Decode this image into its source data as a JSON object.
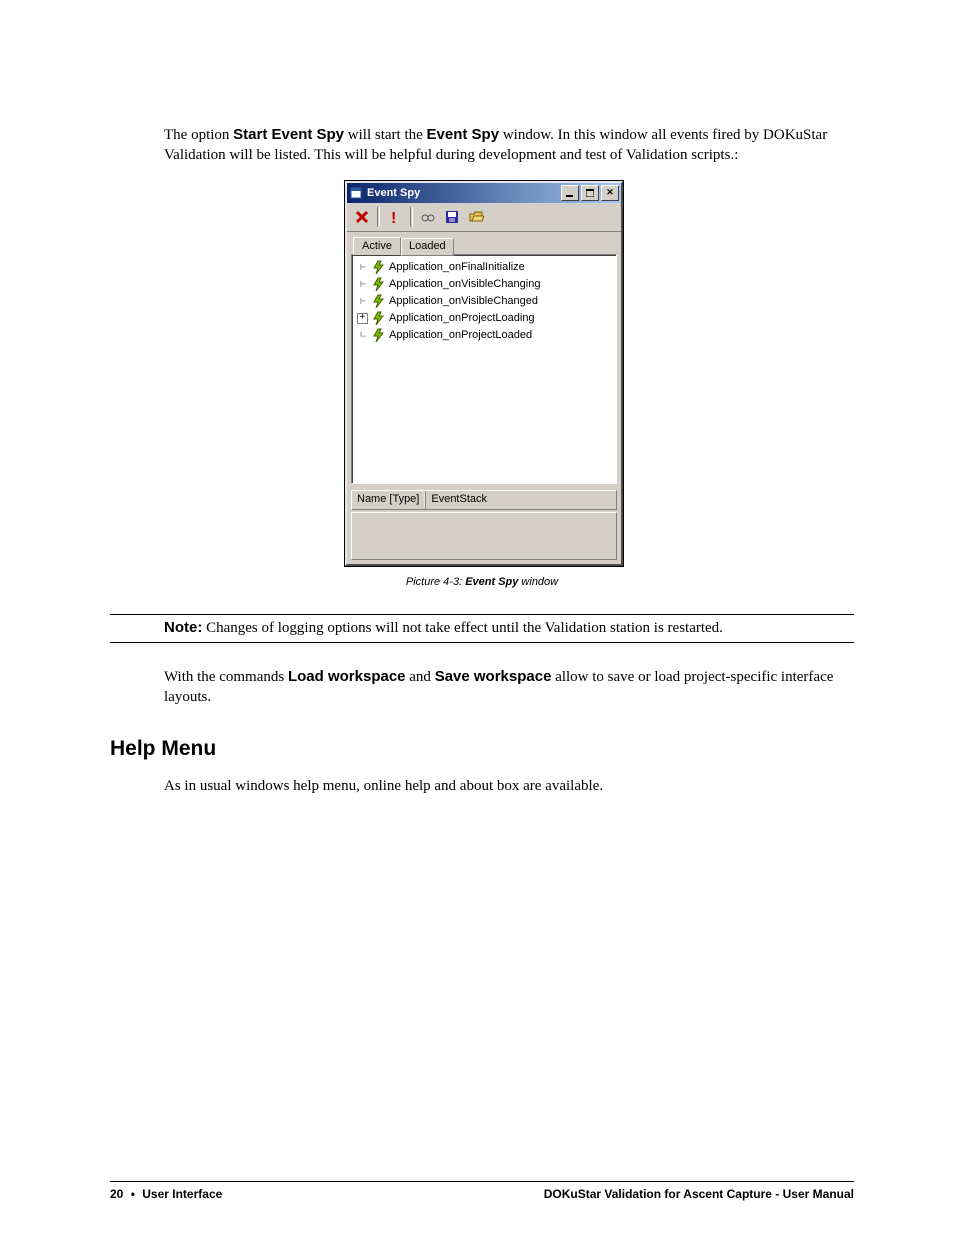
{
  "para1": {
    "t1": "The option ",
    "b1": "Start Event Spy",
    "t2": " will start the ",
    "b2": "Event Spy",
    "t3": " window. In this window all events fired by DOKuStar Validation will be listed. This will be helpful during development and test of Validation scripts.:"
  },
  "window": {
    "title": "Event Spy",
    "tabs": {
      "active": "Active",
      "loaded": "Loaded"
    },
    "tree": [
      {
        "expand": "",
        "label": "Application_onFinalInitialize"
      },
      {
        "expand": "",
        "label": "Application_onVisibleChanging"
      },
      {
        "expand": "",
        "label": "Application_onVisibleChanged"
      },
      {
        "expand": "+",
        "label": "Application_onProjectLoading"
      },
      {
        "expand": "",
        "label": "Application_onProjectLoaded"
      }
    ],
    "detail": {
      "label": "Name [Type]",
      "value": "EventStack"
    }
  },
  "caption": {
    "pre": "Picture 4-3: ",
    "bold": "Event Spy",
    "post": " window"
  },
  "note": {
    "label": "Note:",
    "text": " Changes of logging options will not take effect until the Validation station is restarted."
  },
  "para2": {
    "t1": "With the commands ",
    "b1": "Load workspace",
    "t2": " and ",
    "b2": "Save workspace",
    "t3": " allow to save or load project-specific interface layouts."
  },
  "heading": "Help Menu",
  "para3": "As in usual windows help menu, online help and about box are available.",
  "footer": {
    "pagenum": "20",
    "dot": "•",
    "section": "User Interface",
    "right": "DOKuStar Validation for Ascent Capture -  User Manual"
  }
}
